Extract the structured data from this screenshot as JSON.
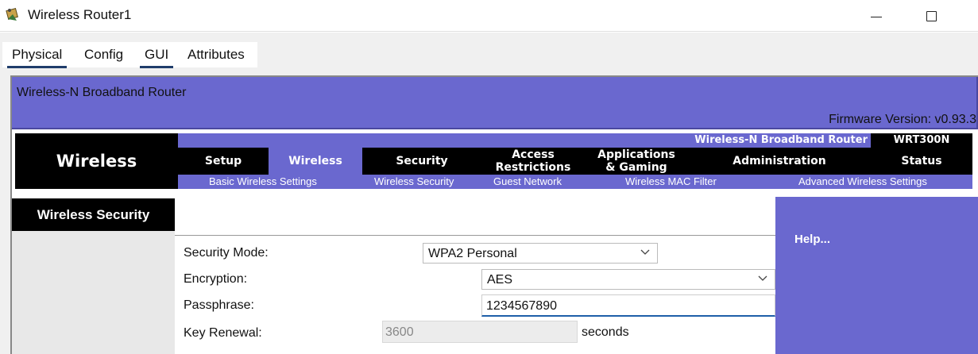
{
  "window": {
    "title": "Wireless Router1"
  },
  "tabs": [
    "Physical",
    "Config",
    "GUI",
    "Attributes"
  ],
  "header": {
    "product_name": "Wireless-N Broadband Router",
    "firmware": "Firmware Version: v0.93.3"
  },
  "nav": {
    "section": "Wireless",
    "brand": "Wireless-N Broadband Router",
    "model": "WRT300N",
    "menu": [
      "Setup",
      "Wireless",
      "Security",
      "Access\nRestrictions",
      "Applications\n& Gaming",
      "Administration",
      "Status"
    ],
    "submenu": [
      "Basic Wireless Settings",
      "Wireless Security",
      "Guest Network",
      "Wireless MAC Filter",
      "Advanced Wireless Settings"
    ]
  },
  "content": {
    "section_title": "Wireless Security",
    "help": "Help...",
    "security_mode_label": "Security Mode:",
    "security_mode_value": "WPA2 Personal",
    "encryption_label": "Encryption:",
    "encryption_value": "AES",
    "passphrase_label": "Passphrase:",
    "passphrase_value": "1234567890",
    "key_renewal_label": "Key Renewal:",
    "key_renewal_value": "3600",
    "key_renewal_unit": "seconds"
  },
  "colors": {
    "accent": "#6a68cf",
    "nav_bg": "#000000",
    "tab_underline": "#1f3d6b"
  }
}
